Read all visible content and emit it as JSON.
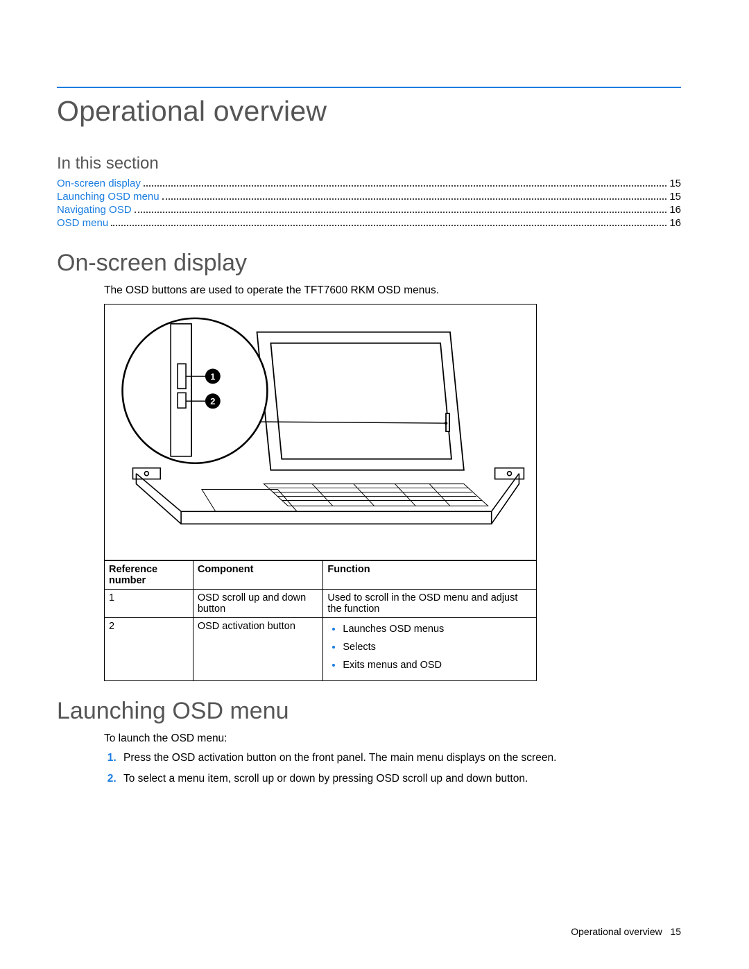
{
  "header": {
    "title": "Operational overview"
  },
  "toc": {
    "heading": "In this section",
    "items": [
      {
        "label": "On-screen display",
        "page": "15"
      },
      {
        "label": "Launching OSD menu",
        "page": "15"
      },
      {
        "label": "Navigating OSD",
        "page": "16"
      },
      {
        "label": "OSD menu",
        "page": "16"
      }
    ]
  },
  "section_osd": {
    "heading": "On-screen display",
    "intro": "The OSD buttons are used to operate the TFT7600 RKM OSD menus.",
    "callouts": {
      "one": "1",
      "two": "2"
    },
    "table": {
      "headers": {
        "ref": "Reference number",
        "comp": "Component",
        "func": "Function"
      },
      "rows": [
        {
          "ref": "1",
          "comp": "OSD scroll up and down button",
          "func_text": "Used to scroll in the OSD menu and adjust the function"
        },
        {
          "ref": "2",
          "comp": "OSD activation button",
          "func_list": [
            "Launches OSD menus",
            "Selects",
            "Exits menus and OSD"
          ]
        }
      ]
    }
  },
  "section_launch": {
    "heading": "Launching OSD menu",
    "intro": "To launch the OSD menu:",
    "steps": [
      "Press the OSD activation button on the front panel. The main menu displays on the screen.",
      "To select a menu item, scroll up or down by pressing OSD scroll up and down button."
    ]
  },
  "footer": {
    "section": "Operational overview",
    "page": "15"
  }
}
